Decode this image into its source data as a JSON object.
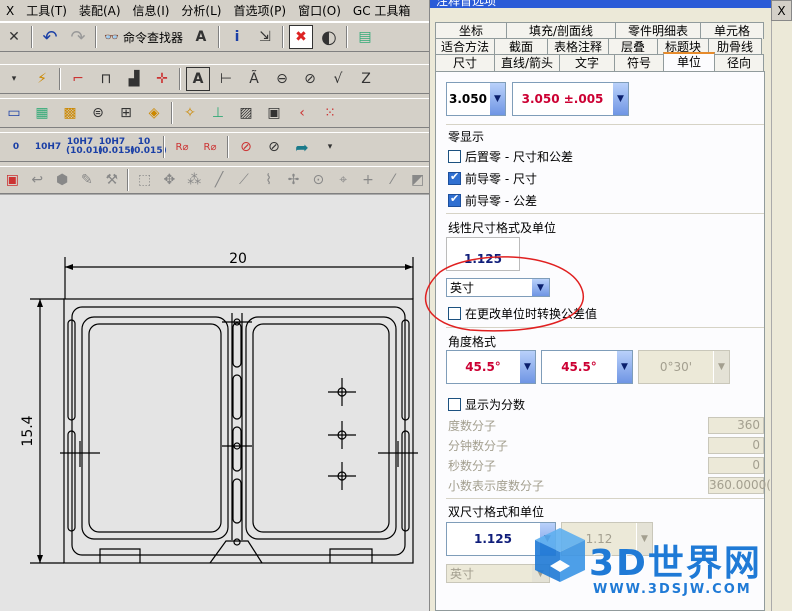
{
  "menu": [
    "X",
    "工具(T)",
    "装配(A)",
    "信息(I)",
    "分析(L)",
    "首选项(P)",
    "窗口(O)",
    "GC 工具箱"
  ],
  "toolbar": {
    "command_finder_label": "命令查找器",
    "tolerance_buttons": [
      {
        "main": "0",
        "sub": ""
      },
      {
        "main": "10H7",
        "sub": ""
      },
      {
        "main": "10H7",
        "sub": "(10.01)"
      },
      {
        "main": "10H7",
        "sub": "(0.015)"
      },
      {
        "main": "10",
        "sub": "(0.015)"
      }
    ]
  },
  "drawing": {
    "dim_horizontal": "20",
    "dim_vertical": "15.4"
  },
  "dialog": {
    "title": "注释首选项",
    "tabs_row1": [
      "坐标",
      "填充/剖面线",
      "零件明细表",
      "单元格"
    ],
    "tabs_row2": [
      "适合方法",
      "截面",
      "表格注释",
      "层叠",
      "标题块",
      "肋骨线"
    ],
    "tabs_row3": [
      "尺寸",
      "直线/箭头",
      "文字",
      "符号",
      "单位",
      "径向"
    ],
    "active_tab": "单位",
    "top_dropdown_1": "3.050",
    "top_dropdown_2": "3.050 ±.005",
    "zero_display": {
      "label": "零显示",
      "options": [
        {
          "label": "后置零 - 尺寸和公差",
          "checked": false
        },
        {
          "label": "前导零 - 尺寸",
          "checked": true
        },
        {
          "label": "前导零 - 公差",
          "checked": true
        }
      ]
    },
    "linear": {
      "label": "线性尺寸格式及单位",
      "preview": "1.125",
      "unit": "英寸",
      "convert_tolerance_label": "在更改单位时转换公差值",
      "convert_tolerance_checked": false
    },
    "angle": {
      "label": "角度格式",
      "format1": "45.5°",
      "format2": "45.5°",
      "format3": "0°30'",
      "show_fraction_label": "显示为分数",
      "show_fraction_checked": false,
      "fields": [
        {
          "label": "度数分子",
          "value": "360"
        },
        {
          "label": "分钟数分子",
          "value": "0"
        },
        {
          "label": "秒数分子",
          "value": "0"
        },
        {
          "label": "小数表示度数分子",
          "value": "360.0000("
        }
      ]
    },
    "dual": {
      "label": "双尺寸格式和单位",
      "preview": "1.125",
      "preview2": "1.12",
      "unit": "英寸"
    },
    "close_label": "X"
  },
  "watermark": {
    "brand": "3D世界网",
    "url": "WWW.3DSJW.COM"
  },
  "colors": {
    "accent_blue": "#2f6fd1",
    "annotation_red": "#e02020",
    "watermark_blue": "#1f7ad6"
  }
}
